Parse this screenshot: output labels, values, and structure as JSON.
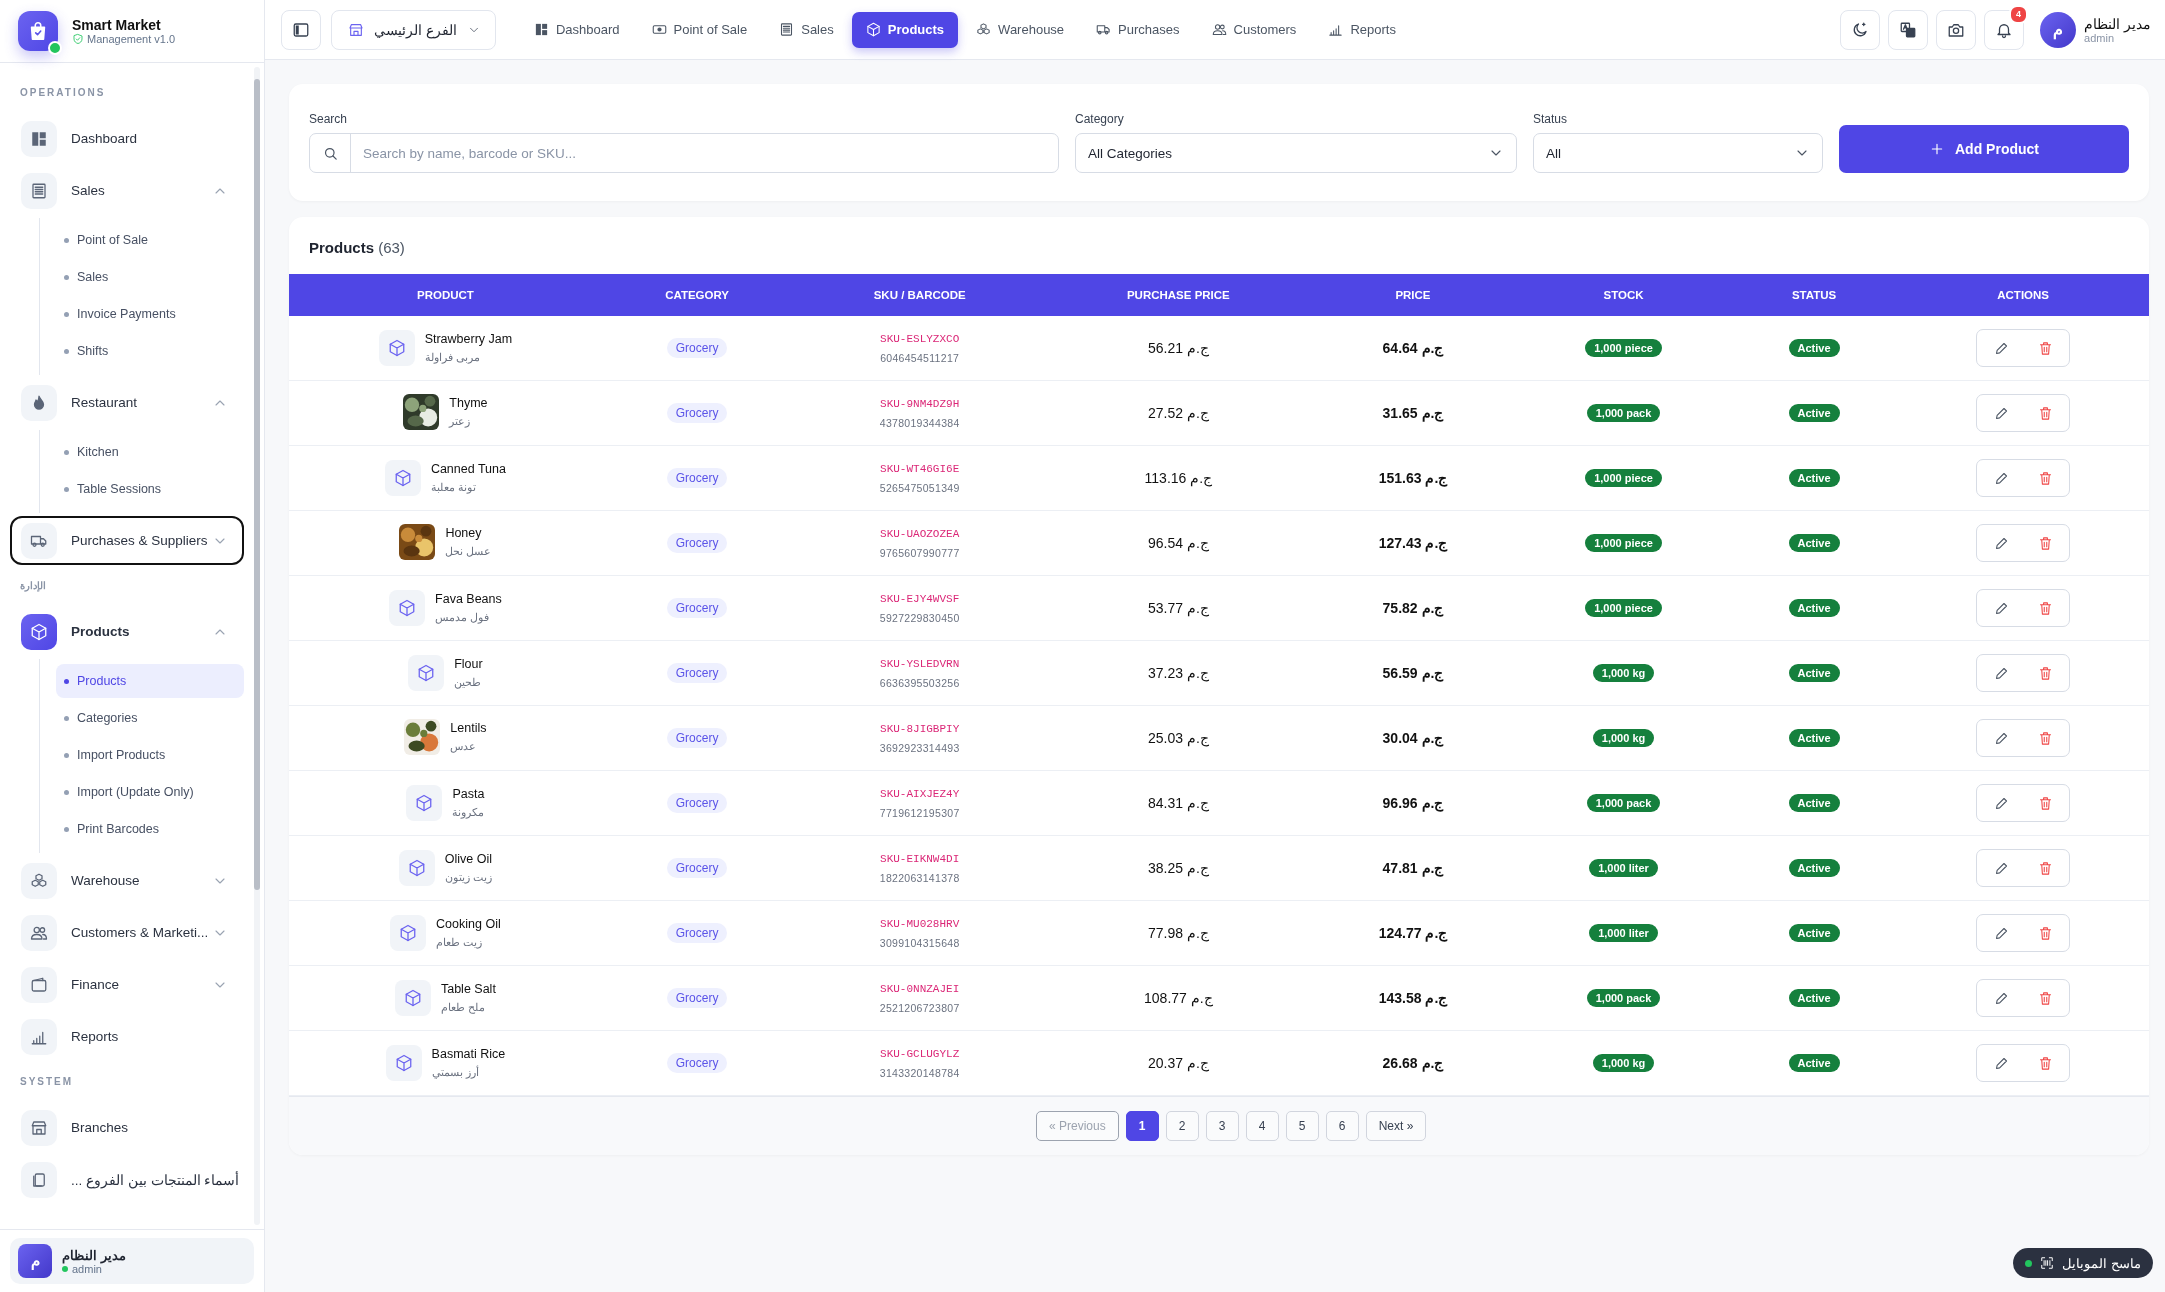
{
  "sidebar": {
    "brand": {
      "name": "Smart Market",
      "subtitle": "Management v1.0",
      "online": true
    },
    "sections": [
      {
        "label": "OPERATIONS",
        "items": [
          {
            "label": "Dashboard",
            "active": false,
            "focused": false
          },
          {
            "label": "Sales",
            "active": false,
            "focused": false,
            "expanded": true,
            "children": [
              {
                "label": "Point of Sale",
                "selected": false
              },
              {
                "label": "Sales",
                "selected": false
              },
              {
                "label": "Invoice Payments",
                "selected": false
              },
              {
                "label": "Shifts",
                "selected": false
              }
            ]
          },
          {
            "label": "Restaurant",
            "active": false,
            "focused": false,
            "expanded": true,
            "children": [
              {
                "label": "Kitchen",
                "selected": false
              },
              {
                "label": "Table Sessions",
                "selected": false
              }
            ]
          },
          {
            "label": "Purchases & Suppliers",
            "active": false,
            "focused": true,
            "expanded": false
          }
        ]
      },
      {
        "label": "الإدارة",
        "items": [
          {
            "label": "Products",
            "active": true,
            "focused": false,
            "expanded": true,
            "children": [
              {
                "label": "Products",
                "selected": true
              },
              {
                "label": "Categories",
                "selected": false
              },
              {
                "label": "Import Products",
                "selected": false
              },
              {
                "label": "Import (Update Only)",
                "selected": false
              },
              {
                "label": "Print Barcodes",
                "selected": false
              }
            ]
          },
          {
            "label": "Warehouse",
            "active": false,
            "focused": false,
            "expanded": false
          },
          {
            "label": "Customers & Marketi...",
            "active": false,
            "focused": false,
            "expanded": false
          },
          {
            "label": "Finance",
            "active": false,
            "focused": false,
            "expanded": false
          },
          {
            "label": "Reports",
            "active": false,
            "focused": false
          }
        ]
      },
      {
        "label": "SYSTEM",
        "items": [
          {
            "label": "Branches",
            "active": false,
            "focused": false
          },
          {
            "label": "... أسماء المنتجات بين الفروع",
            "active": false,
            "focused": false
          }
        ]
      }
    ],
    "user": {
      "name": "مدير النظام",
      "role": "admin",
      "initial": "م",
      "online": true
    }
  },
  "topbar": {
    "branch": "الفرع الرئيسي",
    "tabs": [
      {
        "label": "Dashboard",
        "selected": false
      },
      {
        "label": "Point of Sale",
        "selected": false
      },
      {
        "label": "Sales",
        "selected": false
      },
      {
        "label": "Products",
        "selected": true
      },
      {
        "label": "Warehouse",
        "selected": false
      },
      {
        "label": "Purchases",
        "selected": false
      },
      {
        "label": "Customers",
        "selected": false
      },
      {
        "label": "Reports",
        "selected": false
      }
    ],
    "notifications": "4",
    "user": {
      "name": "مدير النظام",
      "role": "admin",
      "initial": "م"
    }
  },
  "filters": {
    "search": {
      "label": "Search",
      "placeholder": "Search by name, barcode or SKU..."
    },
    "category": {
      "label": "Category",
      "value": "All Categories"
    },
    "status": {
      "label": "Status",
      "value": "All"
    },
    "add_button": "Add Product"
  },
  "table": {
    "title": "Products",
    "count": "(63)",
    "columns": [
      "PRODUCT",
      "CATEGORY",
      "SKU / BARCODE",
      "PURCHASE PRICE",
      "PRICE",
      "STOCK",
      "STATUS",
      "ACTIONS"
    ],
    "rows": [
      {
        "name": "Strawberry Jam",
        "name_ar": "مربى فراولة",
        "kind": "icon",
        "category": "Grocery",
        "sku": "SKU-ESLYZXCO",
        "barcode": "6046454511217",
        "purchase_price": "56.21 ج.م",
        "price": "64.64 ج.م",
        "stock": "1,000 piece",
        "status": "Active"
      },
      {
        "name": "Thyme",
        "name_ar": "زعتر",
        "kind": "picture",
        "category": "Grocery",
        "sku": "SKU-9NM4DZ9H",
        "barcode": "4378019344384",
        "purchase_price": "27.52 ج.م",
        "price": "31.65 ج.م",
        "stock": "1,000 pack",
        "status": "Active"
      },
      {
        "name": "Canned Tuna",
        "name_ar": "تونة معلبة",
        "kind": "icon",
        "category": "Grocery",
        "sku": "SKU-WT46GI6E",
        "barcode": "5265475051349",
        "purchase_price": "113.16 ج.م",
        "price": "151.63 ج.م",
        "stock": "1,000 piece",
        "status": "Active"
      },
      {
        "name": "Honey",
        "name_ar": "عسل نحل",
        "kind": "picture",
        "category": "Grocery",
        "sku": "SKU-UAOZOZEA",
        "barcode": "9765607990777",
        "purchase_price": "96.54 ج.م",
        "price": "127.43 ج.م",
        "stock": "1,000 piece",
        "status": "Active"
      },
      {
        "name": "Fava Beans",
        "name_ar": "فول مدمس",
        "kind": "icon",
        "category": "Grocery",
        "sku": "SKU-EJY4WVSF",
        "barcode": "5927229830450",
        "purchase_price": "53.77 ج.م",
        "price": "75.82 ج.م",
        "stock": "1,000 piece",
        "status": "Active"
      },
      {
        "name": "Flour",
        "name_ar": "طحين",
        "kind": "icon",
        "category": "Grocery",
        "sku": "SKU-YSLEDVRN",
        "barcode": "6636395503256",
        "purchase_price": "37.23 ج.م",
        "price": "56.59 ج.م",
        "stock": "1,000 kg",
        "status": "Active"
      },
      {
        "name": "Lentils",
        "name_ar": "عدس",
        "kind": "picture",
        "category": "Grocery",
        "sku": "SKU-8JIGBPIY",
        "barcode": "3692923314493",
        "purchase_price": "25.03 ج.م",
        "price": "30.04 ج.م",
        "stock": "1,000 kg",
        "status": "Active"
      },
      {
        "name": "Pasta",
        "name_ar": "مكرونة",
        "kind": "icon",
        "category": "Grocery",
        "sku": "SKU-AIXJEZ4Y",
        "barcode": "7719612195307",
        "purchase_price": "84.31 ج.م",
        "price": "96.96 ج.م",
        "stock": "1,000 pack",
        "status": "Active"
      },
      {
        "name": "Olive Oil",
        "name_ar": "زيت زيتون",
        "kind": "icon",
        "category": "Grocery",
        "sku": "SKU-EIKNW4DI",
        "barcode": "1822063141378",
        "purchase_price": "38.25 ج.م",
        "price": "47.81 ج.م",
        "stock": "1,000 liter",
        "status": "Active"
      },
      {
        "name": "Cooking Oil",
        "name_ar": "زيت طعام",
        "kind": "icon",
        "category": "Grocery",
        "sku": "SKU-MU028HRV",
        "barcode": "3099104315648",
        "purchase_price": "77.98 ج.م",
        "price": "124.77 ج.م",
        "stock": "1,000 liter",
        "status": "Active"
      },
      {
        "name": "Table Salt",
        "name_ar": "ملح طعام",
        "kind": "icon",
        "category": "Grocery",
        "sku": "SKU-0NNZAJEI",
        "barcode": "2521206723807",
        "purchase_price": "108.77 ج.م",
        "price": "143.58 ج.م",
        "stock": "1,000 pack",
        "status": "Active"
      },
      {
        "name": "Basmati Rice",
        "name_ar": "أرز بسمتي",
        "kind": "icon",
        "category": "Grocery",
        "sku": "SKU-GCLUGYLZ",
        "barcode": "3143320148784",
        "purchase_price": "20.37 ج.م",
        "price": "26.68 ج.م",
        "stock": "1,000 kg",
        "status": "Active"
      }
    ]
  },
  "pagination": {
    "previous": {
      "label": "« Previous",
      "disabled": true
    },
    "pages": [
      {
        "label": "1",
        "selected": true
      },
      {
        "label": "2",
        "selected": false
      },
      {
        "label": "3",
        "selected": false
      },
      {
        "label": "4",
        "selected": false
      },
      {
        "label": "5",
        "selected": false
      },
      {
        "label": "6",
        "selected": false
      }
    ],
    "next": {
      "label": "Next »",
      "disabled": false
    }
  },
  "scanner": {
    "label": "ماسح الموبايل",
    "online": true
  }
}
